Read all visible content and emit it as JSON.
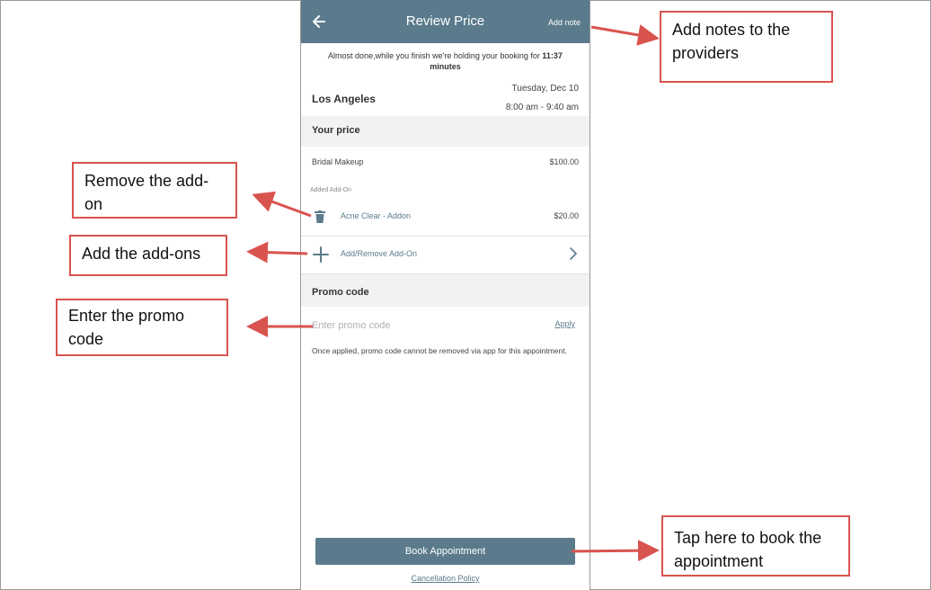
{
  "header": {
    "back_icon": "arrow-left-icon",
    "title": "Review Price",
    "add_note": "Add note"
  },
  "hold_message": {
    "text": "Almost done,while you finish we're holding your booking for ",
    "time": "11:37 minutes"
  },
  "booking": {
    "city": "Los Angeles",
    "date": "Tuesday, Dec 10",
    "time": "8:00 am - 9:40 am"
  },
  "price_section": {
    "heading": "Your price",
    "service": {
      "name": "Bridal Makeup",
      "price": "$100.00"
    },
    "added_caption": "Added Add-On",
    "addon": {
      "name": "Acne Clear - Addon",
      "price": "$20.00",
      "remove_icon": "trash-icon"
    },
    "add_remove_label": "Add/Remove Add-On"
  },
  "promo": {
    "heading": "Promo code",
    "placeholder": "Enter promo code",
    "apply_label": "Apply",
    "note": "Once applied, promo code cannot be removed via app for this appointment."
  },
  "footer": {
    "book_label": "Book Appointment",
    "cancellation_label": "Cancellation Policy"
  },
  "callouts": {
    "add_notes": "Add notes to the providers",
    "remove_addon": "Remove the add-on",
    "add_addons": "Add the add-ons",
    "promo": "Enter the promo code",
    "book": "Tap here to book the appointment"
  },
  "colors": {
    "accent": "#5b7b8c",
    "callout_border": "#d9534f",
    "arrow": "#d9534f"
  }
}
